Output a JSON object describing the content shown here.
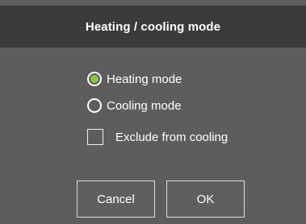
{
  "dialog": {
    "title": "Heating / cooling mode",
    "options": {
      "heating": {
        "label": "Heating mode",
        "selected": true
      },
      "cooling": {
        "label": "Cooling mode",
        "selected": false
      },
      "exclude": {
        "label": "Exclude from cooling",
        "checked": false
      }
    },
    "buttons": {
      "cancel": "Cancel",
      "ok": "OK"
    }
  },
  "colors": {
    "accent": "#8cc63f",
    "background": "#5d5d5d",
    "titlebar": "#3b3b3b"
  }
}
